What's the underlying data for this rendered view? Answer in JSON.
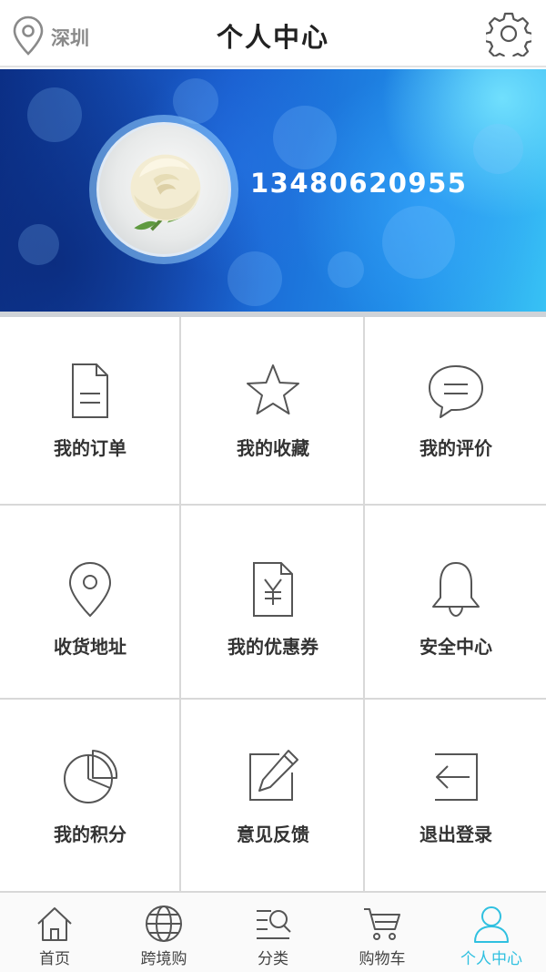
{
  "header": {
    "location": "深圳",
    "title": "个人中心",
    "location_icon": "location-pin-icon",
    "settings_icon": "gear-icon"
  },
  "profile": {
    "phone": "13480620955",
    "avatar": "white-rose-avatar"
  },
  "menu": [
    {
      "label": "我的订单",
      "icon": "document-icon"
    },
    {
      "label": "我的收藏",
      "icon": "star-icon"
    },
    {
      "label": "我的评价",
      "icon": "chat-bubble-icon"
    },
    {
      "label": "收货地址",
      "icon": "location-pin-icon"
    },
    {
      "label": "我的优惠券",
      "icon": "coupon-icon"
    },
    {
      "label": "安全中心",
      "icon": "bell-icon"
    },
    {
      "label": "我的积分",
      "icon": "pie-chart-icon"
    },
    {
      "label": "意见反馈",
      "icon": "edit-icon"
    },
    {
      "label": "退出登录",
      "icon": "logout-icon"
    }
  ],
  "tabs": [
    {
      "label": "首页",
      "icon": "home-icon",
      "active": false
    },
    {
      "label": "跨境购",
      "icon": "globe-icon",
      "active": false
    },
    {
      "label": "分类",
      "icon": "category-search-icon",
      "active": false
    },
    {
      "label": "购物车",
      "icon": "cart-icon",
      "active": false
    },
    {
      "label": "个人中心",
      "icon": "user-icon",
      "active": true
    }
  ],
  "colors": {
    "accent": "#2fc0e0",
    "banner_dark": "#0b2f86",
    "banner_light": "#38c2f5",
    "text": "#333333",
    "divider": "#d8d8d8"
  }
}
